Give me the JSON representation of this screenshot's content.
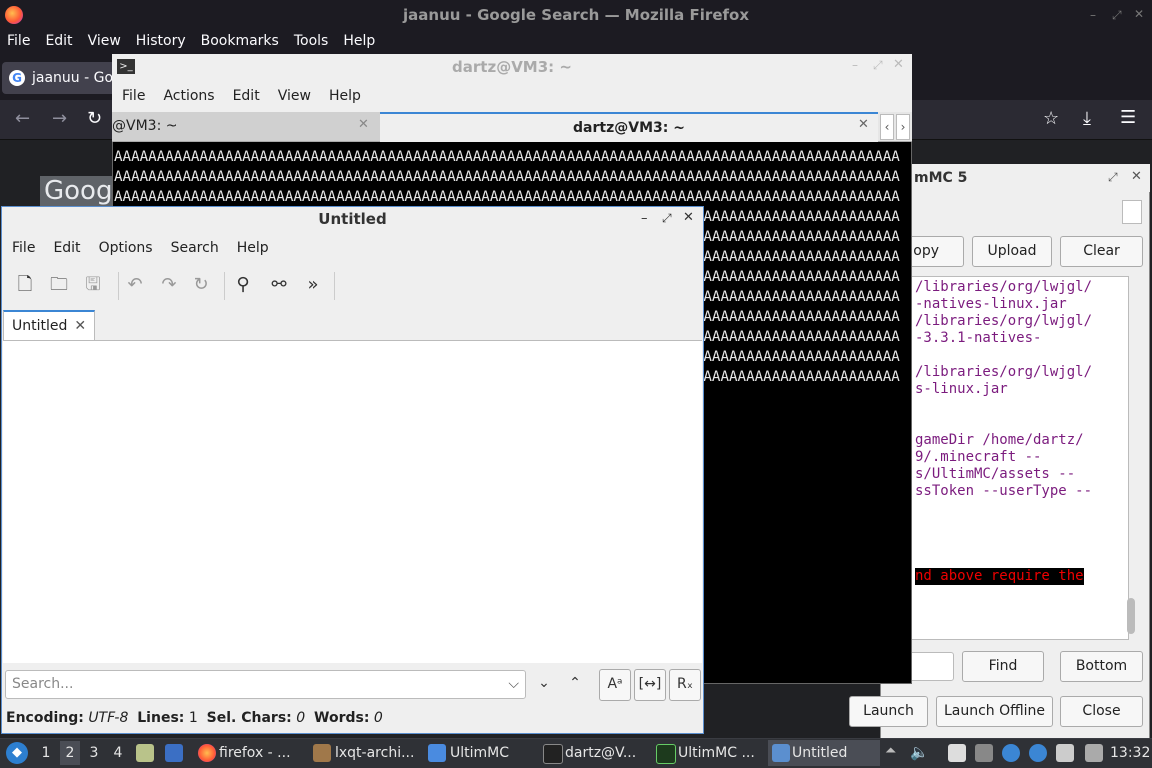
{
  "firefox": {
    "title": "jaanuu - Google Search — Mozilla Firefox",
    "menu": [
      "File",
      "Edit",
      "View",
      "History",
      "Bookmarks",
      "Tools",
      "Help"
    ],
    "tab_title": "jaanuu - Goo",
    "logo_text": "Goog"
  },
  "terminal": {
    "title": "dartz@VM3: ~",
    "menu": [
      "File",
      "Actions",
      "Edit",
      "View",
      "Help"
    ],
    "tab1": "@VM3: ~",
    "tab2": "dartz@VM3: ~",
    "lines": [
      "AAAAAAAAAAAAAAAAAAAAAAAAAAAAAAAAAAAAAAAAAAAAAAAAAAAAAAAAAAAAAAAAAAAAAAAAAAAAAAAAAAAAAAAAAAAA",
      "AAAAAAAAAAAAAAAAAAAAAAAAAAAAAAAAAAAAAAAAAAAAAAAAAAAAAAAAAAAAAAAAAAAAAAAAAAAAAAAAAAAAAAAAAAAA",
      "AAAAAAAAAAAAAAAAAAAAAAAAAAAAAAAAAAAAAAAAAAAAAAAAAAAAAAAAAAAAAAAAAAAAAAAAAAAAAAAAAAAAAAAAAAAA",
      "AAAAAAAAAAAAAAAAAAAAAAAAAAAAAAAAAAAAAAAAAAAAAAAAAAAAAAAAAAAAAAAAAAAAAAAAAAAAAAAAAAAAAAAAAAAA",
      "AAAAAAAAAAAAAAAAAAAAAAAAAAAAAAAAAAAAAAAAAAAAAAAAAAAAAAAAAAAAAAAAAAAAAAAAAAAAAAAAAAAAAAAAAAAA",
      "AAAAAAAAAAAAAAAAAAAAAAAAAAAAAAAAAAAAAAAAAAAAAAAAAAAAAAAAAAAAAAAAAAAAAAAAAAAAAAAAAAAAAAAAAAAA",
      "AAAAAAAAAAAAAAAAAAAAAAAAAAAAAAAAAAAAAAAAAAAAAAAAAAAAAAAAAAAAAAAAAAAAAAAAAAAAAAAAAAAAAAAAAAAA",
      "AAAAAAAAAAAAAAAAAAAAAAAAAAAAAAAAAAAAAAAAAAAAAAAAAAAAAAAAAAAAAAAAAAAAAAAAAAAAAAAAAAAAAAAAAAAA",
      "AAAAAAAAAAAAAAAAAAAAAAAAAAAAAAAAAAAAAAAAAAAAAAAAAAAAAAAAAAAAAAAAAAAAAAAAAAAAAAAAAAAAAAAAAAAA",
      "AAAAAAAAAAAAAAAAAAAAAAAAAAAAAAAAAAAAAAAAAAAAAAAAAAAAAAAAAAAAAAAAAAAAAAAAAAAAAAAAAAAAAAAAAAAA",
      "AAAAAAAAAAAAAAAAAAAAAAAAAAAAAAAAAAAAAAAAAAAAAAAAAAAAAAAAAAAAAAAAAAAAAAAAAAAAAAAAAAAAAAAAAAAA",
      "AAAAAAAAAAAAAAAAAAAAAAAAAAAAAAAAAAAAAAAAAAAAAAAAAAAAAAAAAAAAAAAAAAAAAAAAAAAAAAAAAAAAAAAAAAAA"
    ]
  },
  "ultimmc": {
    "title": "mMC 5",
    "buttons": {
      "copy": "opy",
      "upload": "Upload",
      "clear": "Clear",
      "find": "Find",
      "bottom": "Bottom",
      "launch": "Launch",
      "launch_offline": "Launch Offline",
      "close": "Close"
    },
    "log_lines": [
      "/libraries/org/lwjgl/",
      "-natives-linux.jar",
      "/libraries/org/lwjgl/",
      "-3.3.1-natives-",
      "",
      "/libraries/org/lwjgl/",
      "s-linux.jar",
      "",
      "",
      "gameDir /home/dartz/",
      "9/.minecraft --",
      "s/UltimMC/assets --",
      "ssToken  --userType  --"
    ],
    "log_error": "nd above require the"
  },
  "featherpad": {
    "title": "Untitled",
    "menu": [
      "File",
      "Edit",
      "Options",
      "Search",
      "Help"
    ],
    "tab": "Untitled",
    "search_placeholder": "Search...",
    "status": {
      "encoding_label": "Encoding:",
      "encoding": "UTF-8",
      "lines_label": "Lines:",
      "lines": "1",
      "sel_label": "Sel. Chars:",
      "sel": "0",
      "words_label": "Words:",
      "words": "0"
    }
  },
  "taskbar": {
    "desktops": [
      "1",
      "2",
      "3",
      "4"
    ],
    "items": [
      "firefox - ...",
      "lxqt-archi...",
      "UltimMC",
      "dartz@V...",
      "UltimMC ...",
      "Untitled"
    ],
    "clock": "13:32"
  }
}
